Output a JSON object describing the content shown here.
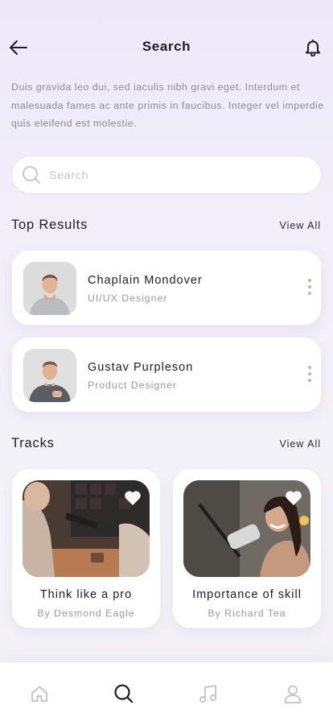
{
  "header": {
    "title": "Search"
  },
  "intro": "Duis gravida leo dui, sed iaculis nibh gravi eget. Interdum et malesuada fames ac ante  primis in faucibus. Integer vel imperdie quis eleifend est molestie.",
  "search": {
    "placeholder": "Search",
    "value": ""
  },
  "top_results": {
    "title": "Top Results",
    "view_all": "View All",
    "items": [
      {
        "name": "Chaplain Mondover",
        "role": "UI/UX Designer"
      },
      {
        "name": "Gustav Purpleson",
        "role": "Product Designer"
      }
    ]
  },
  "tracks": {
    "title": "Tracks",
    "view_all": "View All",
    "items": [
      {
        "title": "Think like a pro",
        "author": "By Desmond Eagle"
      },
      {
        "title": "Importance of skill",
        "author": "By Richard Tea"
      }
    ]
  },
  "tabbar": {
    "active": "search",
    "icons": [
      "home-icon",
      "search-icon",
      "music-icon",
      "profile-icon"
    ]
  },
  "colors": {
    "accent": "#1c1c26",
    "muted": "#9a98a3",
    "background": "#ece8fa"
  }
}
